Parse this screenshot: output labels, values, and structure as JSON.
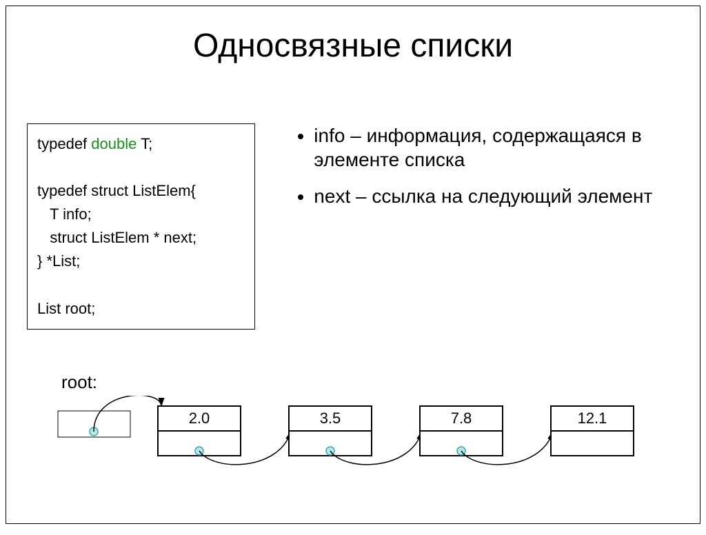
{
  "title": "Односвязные списки",
  "code": {
    "l1a": "typedef ",
    "l1b": "double",
    "l1c": " T;",
    "l2": "",
    "l3": "typedef struct ListElem{",
    "l4": "   T info;",
    "l5": "   struct ListElem * next;",
    "l6": "} *List;",
    "l7": "",
    "l8": "List root;"
  },
  "bullets": [
    "info – информация, содержащаяся в элементе списка",
    "next – ссылка на следующий элемент"
  ],
  "diagram": {
    "root_label": "root:",
    "nodes": [
      "2.0",
      "3.5",
      "7.8",
      "12.1"
    ]
  }
}
